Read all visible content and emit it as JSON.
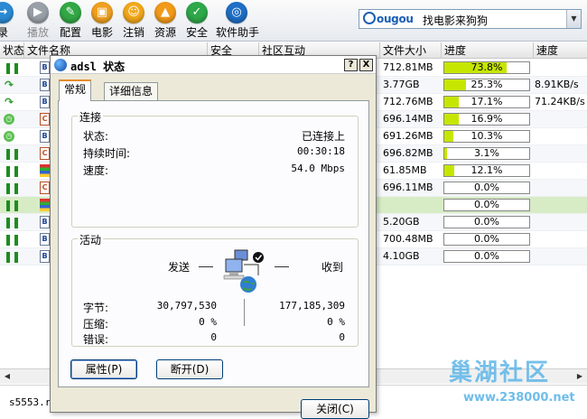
{
  "toolbar": {
    "items": [
      {
        "label": "录",
        "icon": "login-icon",
        "color": "#2a8ad4",
        "disabled": false
      },
      {
        "label": "播放",
        "icon": "play-icon",
        "color": "#9aa0a8",
        "disabled": true
      },
      {
        "label": "配置",
        "icon": "tools-icon",
        "color": "#32a845",
        "disabled": false
      },
      {
        "label": "电影",
        "icon": "movie-icon",
        "color": "#f0a020",
        "disabled": false
      },
      {
        "label": "注销",
        "icon": "user-icon",
        "color": "#f2a81a",
        "disabled": false
      },
      {
        "label": "资源",
        "icon": "upload-icon",
        "color": "#f29a1a",
        "disabled": false
      },
      {
        "label": "安全",
        "icon": "shield-icon",
        "color": "#2ea84a",
        "disabled": false
      },
      {
        "label": "软件助手",
        "icon": "software-helper-icon",
        "color": "#1f6fc6",
        "disabled": false
      }
    ],
    "search_logo": "ougou",
    "search_text": "找电影来狗狗"
  },
  "list": {
    "headers": {
      "status": "状态",
      "name": "文件名称",
      "safety": "安全",
      "community": "社区互动",
      "size": "文件大小",
      "progress": "进度",
      "speed": "速度"
    },
    "rows": [
      {
        "status": "pause",
        "type": "B",
        "size": "712.81MB",
        "progress": "73.8%",
        "pct": 73.8,
        "speed": ""
      },
      {
        "status": "resume",
        "type": "B",
        "size": "3.77GB",
        "progress": "25.3%",
        "pct": 25.3,
        "speed": "8.91KB/s"
      },
      {
        "status": "resume",
        "type": "B",
        "size": "712.76MB",
        "progress": "17.1%",
        "pct": 17.1,
        "speed": "71.24KB/s"
      },
      {
        "status": "wait",
        "type": "C",
        "size": "696.14MB",
        "progress": "16.9%",
        "pct": 16.9,
        "speed": ""
      },
      {
        "status": "wait",
        "type": "B",
        "size": "691.26MB",
        "progress": "10.3%",
        "pct": 10.3,
        "speed": ""
      },
      {
        "status": "pause",
        "type": "C",
        "size": "696.82MB",
        "progress": "3.1%",
        "pct": 3.1,
        "speed": ""
      },
      {
        "status": "pause",
        "type": "M",
        "size": "61.85MB",
        "progress": "12.1%",
        "pct": 12.1,
        "speed": ""
      },
      {
        "status": "pause",
        "type": "C",
        "size": "696.11MB",
        "progress": "0.0%",
        "pct": 0,
        "speed": ""
      },
      {
        "status": "pause",
        "type": "M",
        "size": "",
        "progress": "0.0%",
        "pct": 0,
        "speed": ""
      },
      {
        "status": "pause",
        "type": "B",
        "size": "5.20GB",
        "progress": "0.0%",
        "pct": 0,
        "speed": ""
      },
      {
        "status": "pause",
        "type": "B",
        "size": "700.48MB",
        "progress": "0.0%",
        "pct": 0,
        "speed": ""
      },
      {
        "status": "pause",
        "type": "B",
        "size": "4.10GB",
        "progress": "0.0%",
        "pct": 0,
        "speed": ""
      }
    ]
  },
  "statusbar": {
    "file": "s5553.r",
    "watermark_logo": "巢湖社区",
    "watermark_url": "www.238000.net"
  },
  "dialog": {
    "title": "adsl 状态",
    "help_button": "?",
    "close_button": "X",
    "tabs": [
      "常规",
      "详细信息"
    ],
    "connection": {
      "group_title": "连接",
      "status_label": "状态:",
      "status_value": "已连接上",
      "duration_label": "持续时间:",
      "duration_value": "00:30:18",
      "speed_label": "速度:",
      "speed_value": "54.0 Mbps"
    },
    "activity": {
      "group_title": "活动",
      "sent_label": "发送",
      "received_label": "收到",
      "bytes_label": "字节:",
      "bytes_sent": "30,797,530",
      "bytes_received": "177,185,309",
      "compression_label": "压缩:",
      "compression_sent": "0 %",
      "compression_received": "0 %",
      "errors_label": "错误:",
      "errors_sent": "0",
      "errors_received": "0"
    },
    "properties_button": "属性(P)",
    "disconnect_button": "断开(D)",
    "close_dialog_button": "关闭(C)"
  }
}
